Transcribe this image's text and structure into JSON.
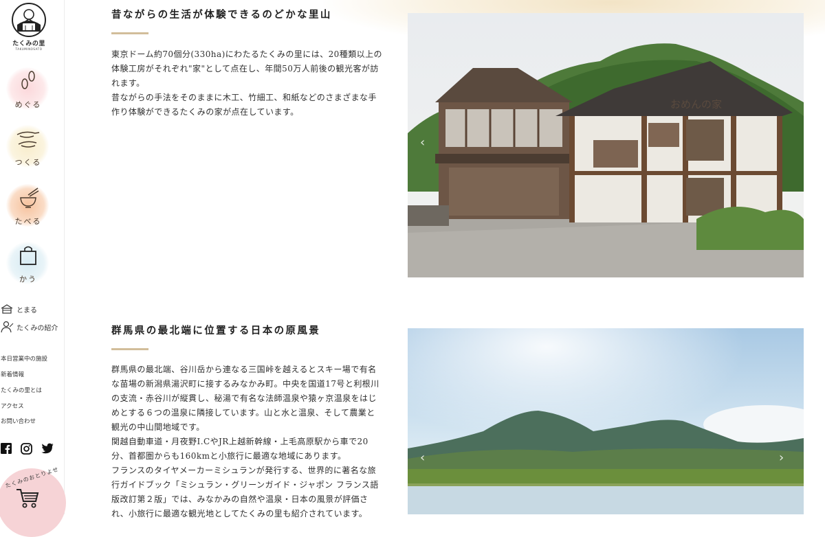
{
  "brand": {
    "name": "たくみの里",
    "sub": "TAKUMINOSATO"
  },
  "nav_main": [
    {
      "label": "めぐる",
      "icon": "footprints-icon"
    },
    {
      "label": "つくる",
      "icon": "hands-icon"
    },
    {
      "label": "たべる",
      "icon": "bowl-chopsticks-icon"
    },
    {
      "label": "かう",
      "icon": "shopping-bag-icon"
    }
  ],
  "nav_sub": [
    {
      "label": "とまる",
      "icon": "house-icon"
    },
    {
      "label": "たくみの紹介",
      "icon": "craftsman-icon"
    }
  ],
  "nav_links": [
    "本日営業中の施設",
    "新着情報",
    "たくみの里とは",
    "アクセス",
    "お問い合わせ"
  ],
  "social": [
    {
      "name": "facebook-icon"
    },
    {
      "name": "instagram-icon"
    },
    {
      "name": "twitter-icon"
    }
  ],
  "shop": {
    "label": "たくみのおとりよせ",
    "icon": "shopping-cart-icon"
  },
  "sections": [
    {
      "title": "昔ながらの生活が体験できるのどかな里山",
      "body": "東京ドーム約70個分(330ha)にわたるたくみの里には、20種類以上の\n体験工房がそれぞれ\"家\"として点在し、年間50万人前後の観光客が訪\nれます。\n昔ながらの手法をそのままに木工、竹細工、和紙などのさまざまな手\n作り体験ができるたくみの家が点在しています。",
      "photo_sign": "おめんの家"
    },
    {
      "title": "群馬県の最北端に位置する日本の原風景",
      "body": "群馬県の最北端、谷川岳から連なる三国峠を越えるとスキー場で有名\nな苗場の新潟県湯沢町に接するみなかみ町。中央を国道17号と利根川\nの支流・赤谷川が縦貫し、秘湯で有名な法師温泉や猿ヶ京温泉をはじ\nめとする６つの温泉に隣接しています。山と水と温泉、そして農業と\n観光の中山間地域です。\n関越自動車道・月夜野I.CやJR上越新幹線・上毛高原駅から車で20\n分、首都圏からも160kmと小旅行に最適な地域にあります。\nフランスのタイヤメーカーミシュランが発行する、世界的に著名な旅\n行ガイドブック「ミシュラン・グリーンガイド・ジャポン フランス語\n版改訂第２版」では、みなかみの自然や温泉・日本の風景が評価さ\nれ、小旅行に最適な観光地としてたくみの里も紹介されています。"
    }
  ],
  "carousel": {
    "prev": "‹",
    "next": "›"
  },
  "colors": {
    "accent_rule": "#d2bd9a",
    "shop_bg": "#f6d3d6",
    "sidebar_border": "#ececec"
  }
}
